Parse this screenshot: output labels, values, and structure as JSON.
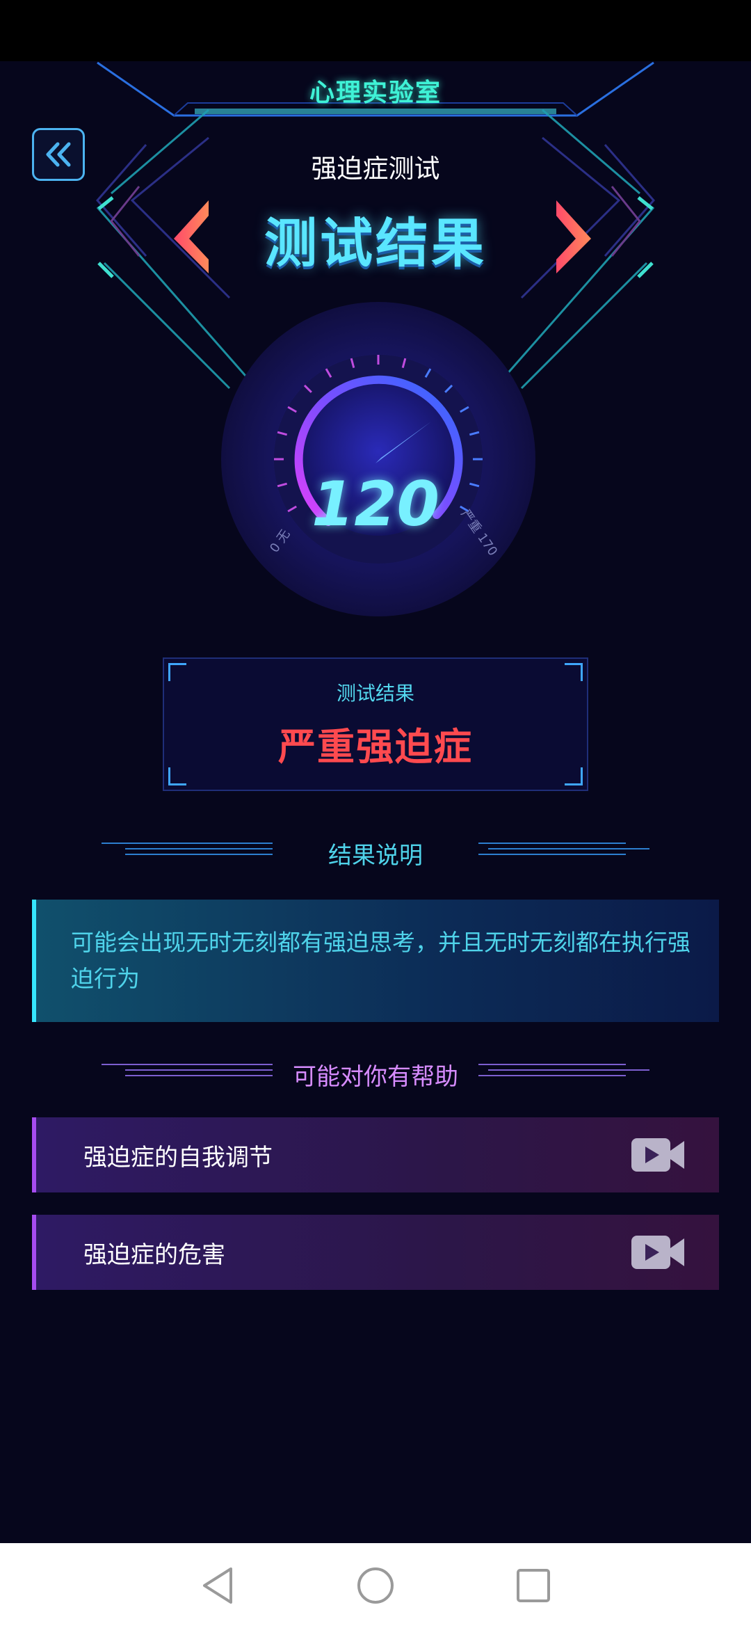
{
  "header": {
    "app_title": "心理实验室",
    "test_name": "强迫症测试",
    "result_heading": "测试结果"
  },
  "gauge": {
    "score": "120",
    "min_label": "0 无",
    "max_label": "严重 170",
    "min": 0,
    "max": 170,
    "value": 120
  },
  "result_box": {
    "label": "测试结果",
    "value": "严重强迫症"
  },
  "description": {
    "title": "结果说明",
    "text": "可能会出现无时无刻都有强迫思考，并且无时无刻都在执行强迫行为"
  },
  "help": {
    "title": "可能对你有帮助",
    "items": [
      {
        "label": "强迫症的自我调节",
        "icon": "video-camera-icon"
      },
      {
        "label": "强迫症的危害",
        "icon": "video-camera-icon"
      }
    ]
  },
  "colors": {
    "background": "#06061c",
    "accent_cyan": "#36e6ff",
    "result_red": "#ff4a4f",
    "help_purple": "#a64cf0",
    "help_title": "#d78cff"
  }
}
